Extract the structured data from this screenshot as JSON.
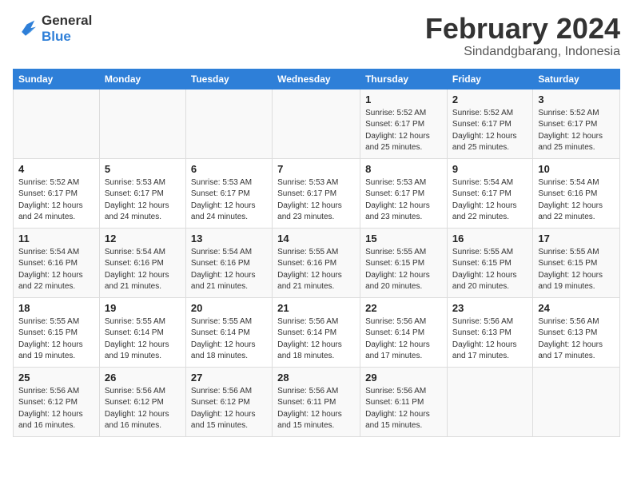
{
  "logo": {
    "line1": "General",
    "line2": "Blue"
  },
  "title": "February 2024",
  "location": "Sindandgbarang, Indonesia",
  "days_header": [
    "Sunday",
    "Monday",
    "Tuesday",
    "Wednesday",
    "Thursday",
    "Friday",
    "Saturday"
  ],
  "weeks": [
    [
      {
        "day": "",
        "info": ""
      },
      {
        "day": "",
        "info": ""
      },
      {
        "day": "",
        "info": ""
      },
      {
        "day": "",
        "info": ""
      },
      {
        "day": "1",
        "info": "Sunrise: 5:52 AM\nSunset: 6:17 PM\nDaylight: 12 hours\nand 25 minutes."
      },
      {
        "day": "2",
        "info": "Sunrise: 5:52 AM\nSunset: 6:17 PM\nDaylight: 12 hours\nand 25 minutes."
      },
      {
        "day": "3",
        "info": "Sunrise: 5:52 AM\nSunset: 6:17 PM\nDaylight: 12 hours\nand 25 minutes."
      }
    ],
    [
      {
        "day": "4",
        "info": "Sunrise: 5:52 AM\nSunset: 6:17 PM\nDaylight: 12 hours\nand 24 minutes."
      },
      {
        "day": "5",
        "info": "Sunrise: 5:53 AM\nSunset: 6:17 PM\nDaylight: 12 hours\nand 24 minutes."
      },
      {
        "day": "6",
        "info": "Sunrise: 5:53 AM\nSunset: 6:17 PM\nDaylight: 12 hours\nand 24 minutes."
      },
      {
        "day": "7",
        "info": "Sunrise: 5:53 AM\nSunset: 6:17 PM\nDaylight: 12 hours\nand 23 minutes."
      },
      {
        "day": "8",
        "info": "Sunrise: 5:53 AM\nSunset: 6:17 PM\nDaylight: 12 hours\nand 23 minutes."
      },
      {
        "day": "9",
        "info": "Sunrise: 5:54 AM\nSunset: 6:17 PM\nDaylight: 12 hours\nand 22 minutes."
      },
      {
        "day": "10",
        "info": "Sunrise: 5:54 AM\nSunset: 6:16 PM\nDaylight: 12 hours\nand 22 minutes."
      }
    ],
    [
      {
        "day": "11",
        "info": "Sunrise: 5:54 AM\nSunset: 6:16 PM\nDaylight: 12 hours\nand 22 minutes."
      },
      {
        "day": "12",
        "info": "Sunrise: 5:54 AM\nSunset: 6:16 PM\nDaylight: 12 hours\nand 21 minutes."
      },
      {
        "day": "13",
        "info": "Sunrise: 5:54 AM\nSunset: 6:16 PM\nDaylight: 12 hours\nand 21 minutes."
      },
      {
        "day": "14",
        "info": "Sunrise: 5:55 AM\nSunset: 6:16 PM\nDaylight: 12 hours\nand 21 minutes."
      },
      {
        "day": "15",
        "info": "Sunrise: 5:55 AM\nSunset: 6:15 PM\nDaylight: 12 hours\nand 20 minutes."
      },
      {
        "day": "16",
        "info": "Sunrise: 5:55 AM\nSunset: 6:15 PM\nDaylight: 12 hours\nand 20 minutes."
      },
      {
        "day": "17",
        "info": "Sunrise: 5:55 AM\nSunset: 6:15 PM\nDaylight: 12 hours\nand 19 minutes."
      }
    ],
    [
      {
        "day": "18",
        "info": "Sunrise: 5:55 AM\nSunset: 6:15 PM\nDaylight: 12 hours\nand 19 minutes."
      },
      {
        "day": "19",
        "info": "Sunrise: 5:55 AM\nSunset: 6:14 PM\nDaylight: 12 hours\nand 19 minutes."
      },
      {
        "day": "20",
        "info": "Sunrise: 5:55 AM\nSunset: 6:14 PM\nDaylight: 12 hours\nand 18 minutes."
      },
      {
        "day": "21",
        "info": "Sunrise: 5:56 AM\nSunset: 6:14 PM\nDaylight: 12 hours\nand 18 minutes."
      },
      {
        "day": "22",
        "info": "Sunrise: 5:56 AM\nSunset: 6:14 PM\nDaylight: 12 hours\nand 17 minutes."
      },
      {
        "day": "23",
        "info": "Sunrise: 5:56 AM\nSunset: 6:13 PM\nDaylight: 12 hours\nand 17 minutes."
      },
      {
        "day": "24",
        "info": "Sunrise: 5:56 AM\nSunset: 6:13 PM\nDaylight: 12 hours\nand 17 minutes."
      }
    ],
    [
      {
        "day": "25",
        "info": "Sunrise: 5:56 AM\nSunset: 6:12 PM\nDaylight: 12 hours\nand 16 minutes."
      },
      {
        "day": "26",
        "info": "Sunrise: 5:56 AM\nSunset: 6:12 PM\nDaylight: 12 hours\nand 16 minutes."
      },
      {
        "day": "27",
        "info": "Sunrise: 5:56 AM\nSunset: 6:12 PM\nDaylight: 12 hours\nand 15 minutes."
      },
      {
        "day": "28",
        "info": "Sunrise: 5:56 AM\nSunset: 6:11 PM\nDaylight: 12 hours\nand 15 minutes."
      },
      {
        "day": "29",
        "info": "Sunrise: 5:56 AM\nSunset: 6:11 PM\nDaylight: 12 hours\nand 15 minutes."
      },
      {
        "day": "",
        "info": ""
      },
      {
        "day": "",
        "info": ""
      }
    ]
  ]
}
